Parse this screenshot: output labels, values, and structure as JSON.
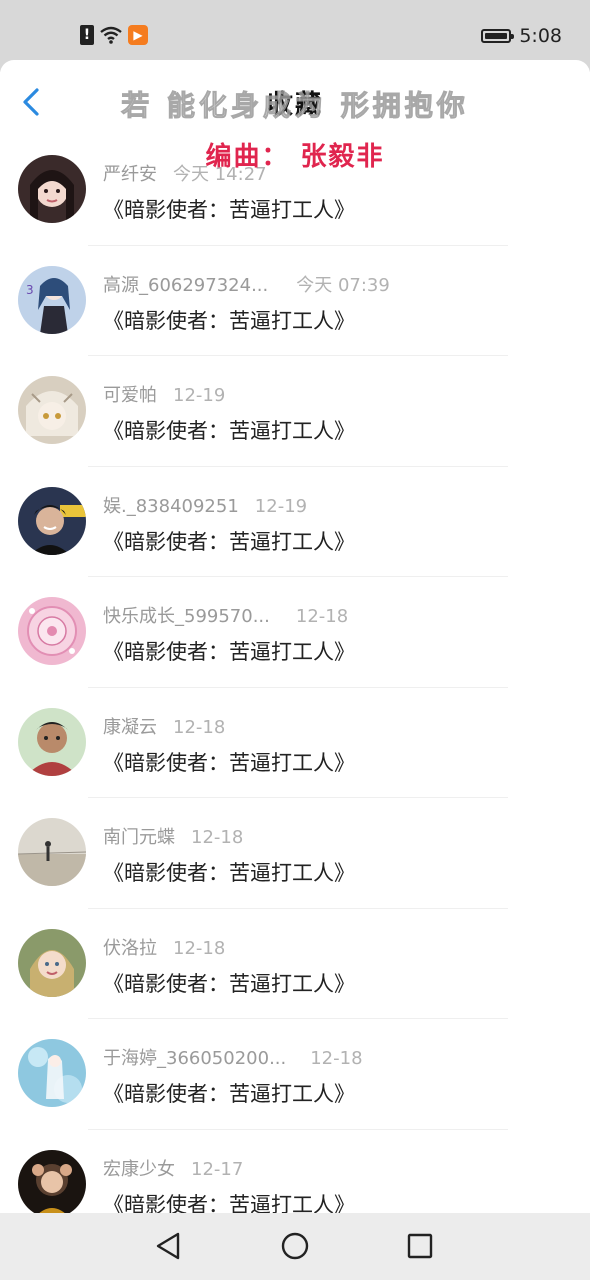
{
  "status_bar": {
    "time": "5:08",
    "icons": [
      "sim-alert-icon",
      "wifi-icon",
      "app-badge-icon",
      "battery-icon"
    ]
  },
  "header": {
    "title": "收藏",
    "back_icon": "chevron-left-icon",
    "lyrics_overlay": "若 能化身成为 形拥抱你",
    "lyrics_credit": "编曲：  张毅非"
  },
  "items": [
    {
      "name": "严纤安",
      "time": "今天 14:27",
      "text": "《暗影使者：苦逼打工人》",
      "avatar_color": "#3a2a2a"
    },
    {
      "name": "高源_606297324...",
      "time": "今天 07:39",
      "text": "《暗影使者：苦逼打工人》",
      "avatar_color": "#8fb0d8"
    },
    {
      "name": "可爱帕",
      "time": "12-19",
      "text": "《暗影使者：苦逼打工人》",
      "avatar_color": "#d8cfc0"
    },
    {
      "name": "娱._838409251",
      "time": "12-19",
      "text": "《暗影使者：苦逼打工人》",
      "avatar_color": "#2a3550"
    },
    {
      "name": "快乐成长_599570...",
      "time": "12-18",
      "text": "《暗影使者：苦逼打工人》",
      "avatar_color": "#f0b8d0"
    },
    {
      "name": "康凝云",
      "time": "12-18",
      "text": "《暗影使者：苦逼打工人》",
      "avatar_color": "#b04040"
    },
    {
      "name": "南门元蝶",
      "time": "12-18",
      "text": "《暗影使者：苦逼打工人》",
      "avatar_color": "#c0b8a8"
    },
    {
      "name": "伏洛拉",
      "time": "12-18",
      "text": "《暗影使者：苦逼打工人》",
      "avatar_color": "#c8b070"
    },
    {
      "name": "于海婷_366050200...",
      "time": "12-18",
      "text": "《暗影使者：苦逼打工人》",
      "avatar_color": "#8ec8e0"
    },
    {
      "name": "宏康少女",
      "time": "12-17",
      "text": "《暗影使者：苦逼打工人》",
      "avatar_color": "#5a4030"
    }
  ],
  "nav_bar": {
    "icons": [
      "nav-back-icon",
      "nav-home-icon",
      "nav-recent-icon"
    ]
  },
  "colors": {
    "accent": "#2b8ae0",
    "lyrics_credit": "#e0254e",
    "name_text": "#9a9a9a",
    "time_text": "#b2b2b2",
    "status_bar_bg": "#d8d8d8",
    "nav_bar_bg": "#ececec"
  }
}
